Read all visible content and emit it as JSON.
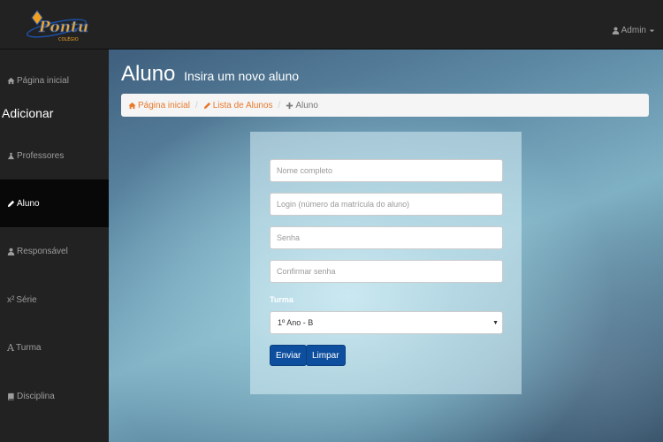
{
  "brand": {
    "logo_text": "Pontual",
    "logo_subtext": "COLÉGIO"
  },
  "topbar": {
    "user_label": "Admin",
    "user_icon": "user-icon",
    "dropdown_icon": "caret-down-icon"
  },
  "sidebar": {
    "home": {
      "label": "Página inicial",
      "icon": "home-icon"
    },
    "section_heading": "Adicionar",
    "items": [
      {
        "label": "Professores",
        "icon": "flask-icon",
        "active": false
      },
      {
        "label": "Aluno",
        "icon": "pencil-icon",
        "active": true
      },
      {
        "label": "Responsável",
        "icon": "user-icon",
        "active": false
      },
      {
        "label": "Série",
        "icon_text": "x²",
        "active": false
      },
      {
        "label": "Turma",
        "icon_text": "A",
        "active": false
      },
      {
        "label": "Disciplina",
        "icon": "book-icon",
        "active": false
      }
    ]
  },
  "page": {
    "title": "Aluno",
    "subtitle": "Insira um novo aluno"
  },
  "breadcrumb": [
    {
      "label": "Página inicial",
      "icon": "home-icon"
    },
    {
      "label": "Lista de Alunos",
      "icon": "pencil-icon"
    },
    {
      "label": "Aluno",
      "icon": "plus-icon"
    }
  ],
  "form": {
    "name_placeholder": "Nome completo",
    "login_placeholder": "Login (número da matrícula do aluno)",
    "password_placeholder": "Senha",
    "confirm_placeholder": "Confirmar senha",
    "turma_label": "Turma",
    "turma_selected": "1º Ano - B",
    "submit_label": "Enviar",
    "reset_label": "Limpar"
  },
  "colors": {
    "nav_bg": "#222222",
    "active_bg": "#080808",
    "link_orange": "#e8782b",
    "button_blue": "#0d4f9e"
  }
}
